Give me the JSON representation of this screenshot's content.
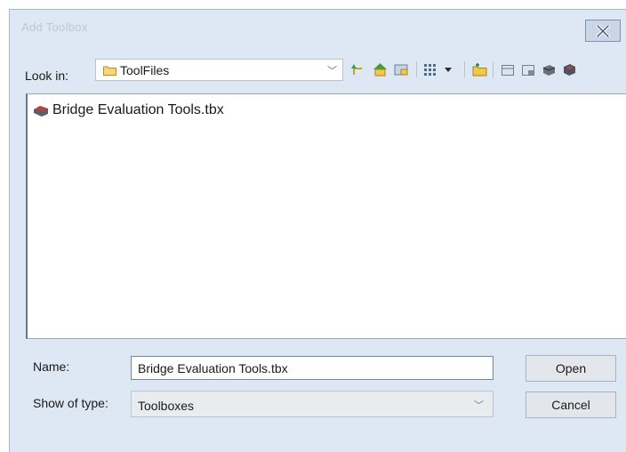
{
  "window": {
    "title": "Add Toolbox"
  },
  "lookin": {
    "label": "Look in:",
    "value": "ToolFiles"
  },
  "toolbar": {
    "icons": [
      "up-one-level-icon",
      "home-icon",
      "connect-folder-icon",
      "view-options-icon",
      "new-folder-icon",
      "new-toolbox-icon",
      "copy-icon",
      "paste-icon",
      "toolbox-icon"
    ]
  },
  "files": [
    {
      "name": "Bridge Evaluation Tools.tbx",
      "icon": "toolbox-icon"
    }
  ],
  "name_field": {
    "label": "Name:",
    "value": "Bridge Evaluation Tools.tbx"
  },
  "type_field": {
    "label": "Show of type:",
    "value": "Toolboxes"
  },
  "buttons": {
    "open": "Open",
    "cancel": "Cancel"
  }
}
